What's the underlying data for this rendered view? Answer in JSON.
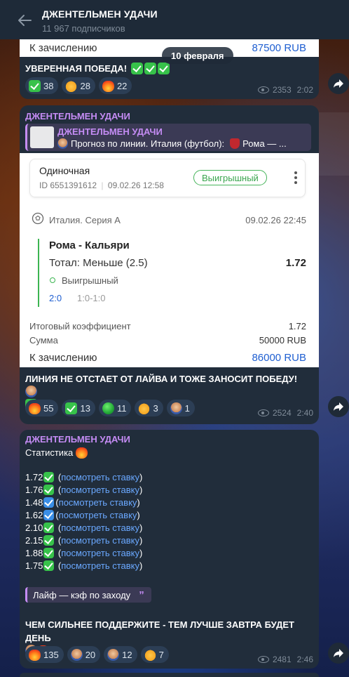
{
  "header": {
    "title": "ДЖЕНТЕЛЬМЕН УДАЧИ",
    "subtitle": "11 967 подписчиков"
  },
  "date_pill": "10 февраля",
  "msg1": {
    "credit_label": "К зачислению",
    "credit_value": "87500 RUB",
    "text": "УВЕРЕННАЯ ПОБЕДА!",
    "reactions": [
      {
        "icon": "check-icon",
        "count": "38"
      },
      {
        "icon": "thumbs-up-icon",
        "count": "28"
      },
      {
        "icon": "fire-icon",
        "count": "22"
      }
    ],
    "views": "2353",
    "time": "2:02"
  },
  "msg2": {
    "author": "ДЖЕНТЕЛЬМЕН УДАЧИ",
    "reply_author": "ДЖЕНТЕЛЬМЕН УДАЧИ",
    "reply_text": "Прогноз по линии. Италия (футбол):",
    "reply_text2": "Рома — ...",
    "bet_type": "Одиночная",
    "bet_id": "ID 6551391612",
    "bet_date": "09.02.26 12:58",
    "status_badge": "Выигрышный",
    "league": "Италия. Серия А",
    "league_date": "09.02.26 22:45",
    "match": "Рома - Кальяри",
    "market": "Тотал: Меньше (2.5)",
    "odds": "1.72",
    "outcome": "Выигрышный",
    "score": "2:0",
    "score_detail": "1:0-1:0",
    "total_coef_label": "Итоговый коэффициент",
    "total_coef_value": "1.72",
    "sum_label": "Сумма",
    "sum_value": "50000 RUB",
    "credit_label": "К зачислению",
    "credit_value": "86000 RUB",
    "text": "ЛИНИЯ НЕ ОТСТАЕТ ОТ ЛАЙВА И ТОЖЕ ЗАНОСИТ ПОБЕДУ!",
    "reactions": [
      {
        "icon": "fire-icon",
        "count": "55"
      },
      {
        "icon": "check-icon",
        "count": "13"
      },
      {
        "icon": "green-circle-icon",
        "count": "11"
      },
      {
        "icon": "thumbs-up-icon",
        "count": "3"
      },
      {
        "icon": "avatar-icon",
        "count": "1"
      }
    ],
    "views": "2524",
    "time": "2:40"
  },
  "msg3": {
    "author": "ДЖЕНТЕЛЬМЕН УДАЧИ",
    "heading": "Статистика",
    "stats": [
      {
        "value": "1.72",
        "icon": "check-icon",
        "link": "посмотреть ставку"
      },
      {
        "value": "1.76",
        "icon": "check-icon",
        "link": "посмотреть ставку"
      },
      {
        "value": "1.48",
        "icon": "blue-check-icon",
        "link": "посмотреть ставку"
      },
      {
        "value": "1.62",
        "icon": "blue-check-icon",
        "link": "посмотреть ставку"
      },
      {
        "value": "2.10",
        "icon": "check-icon",
        "link": "посмотреть ставку"
      },
      {
        "value": "2.15",
        "icon": "check-icon",
        "link": "посмотреть ставку"
      },
      {
        "value": "1.88",
        "icon": "check-icon",
        "link": "посмотреть ставку"
      },
      {
        "value": "1.75",
        "icon": "check-icon",
        "link": "посмотреть ставку"
      }
    ],
    "quote": "Лайф — кэф по заходу",
    "text": "ЧЕМ СИЛЬНЕЕ ПОДДЕРЖИТЕ - ТЕМ ЛУЧШЕ ЗАВТРА БУДЕТ ДЕНЬ",
    "reactions": [
      {
        "icon": "fire-icon",
        "count": "135"
      },
      {
        "icon": "avatar-icon",
        "count": "20"
      },
      {
        "icon": "avatar-icon",
        "count": "12"
      },
      {
        "icon": "thumbs-up-icon",
        "count": "7"
      }
    ],
    "views": "2481",
    "time": "2:46"
  },
  "colors": {
    "accent_author": "#c58cf5",
    "link": "#6aa8ff",
    "win_green": "#37c24a",
    "header_bg": "#1e2a38",
    "bubble_bg": "#212d3b"
  }
}
